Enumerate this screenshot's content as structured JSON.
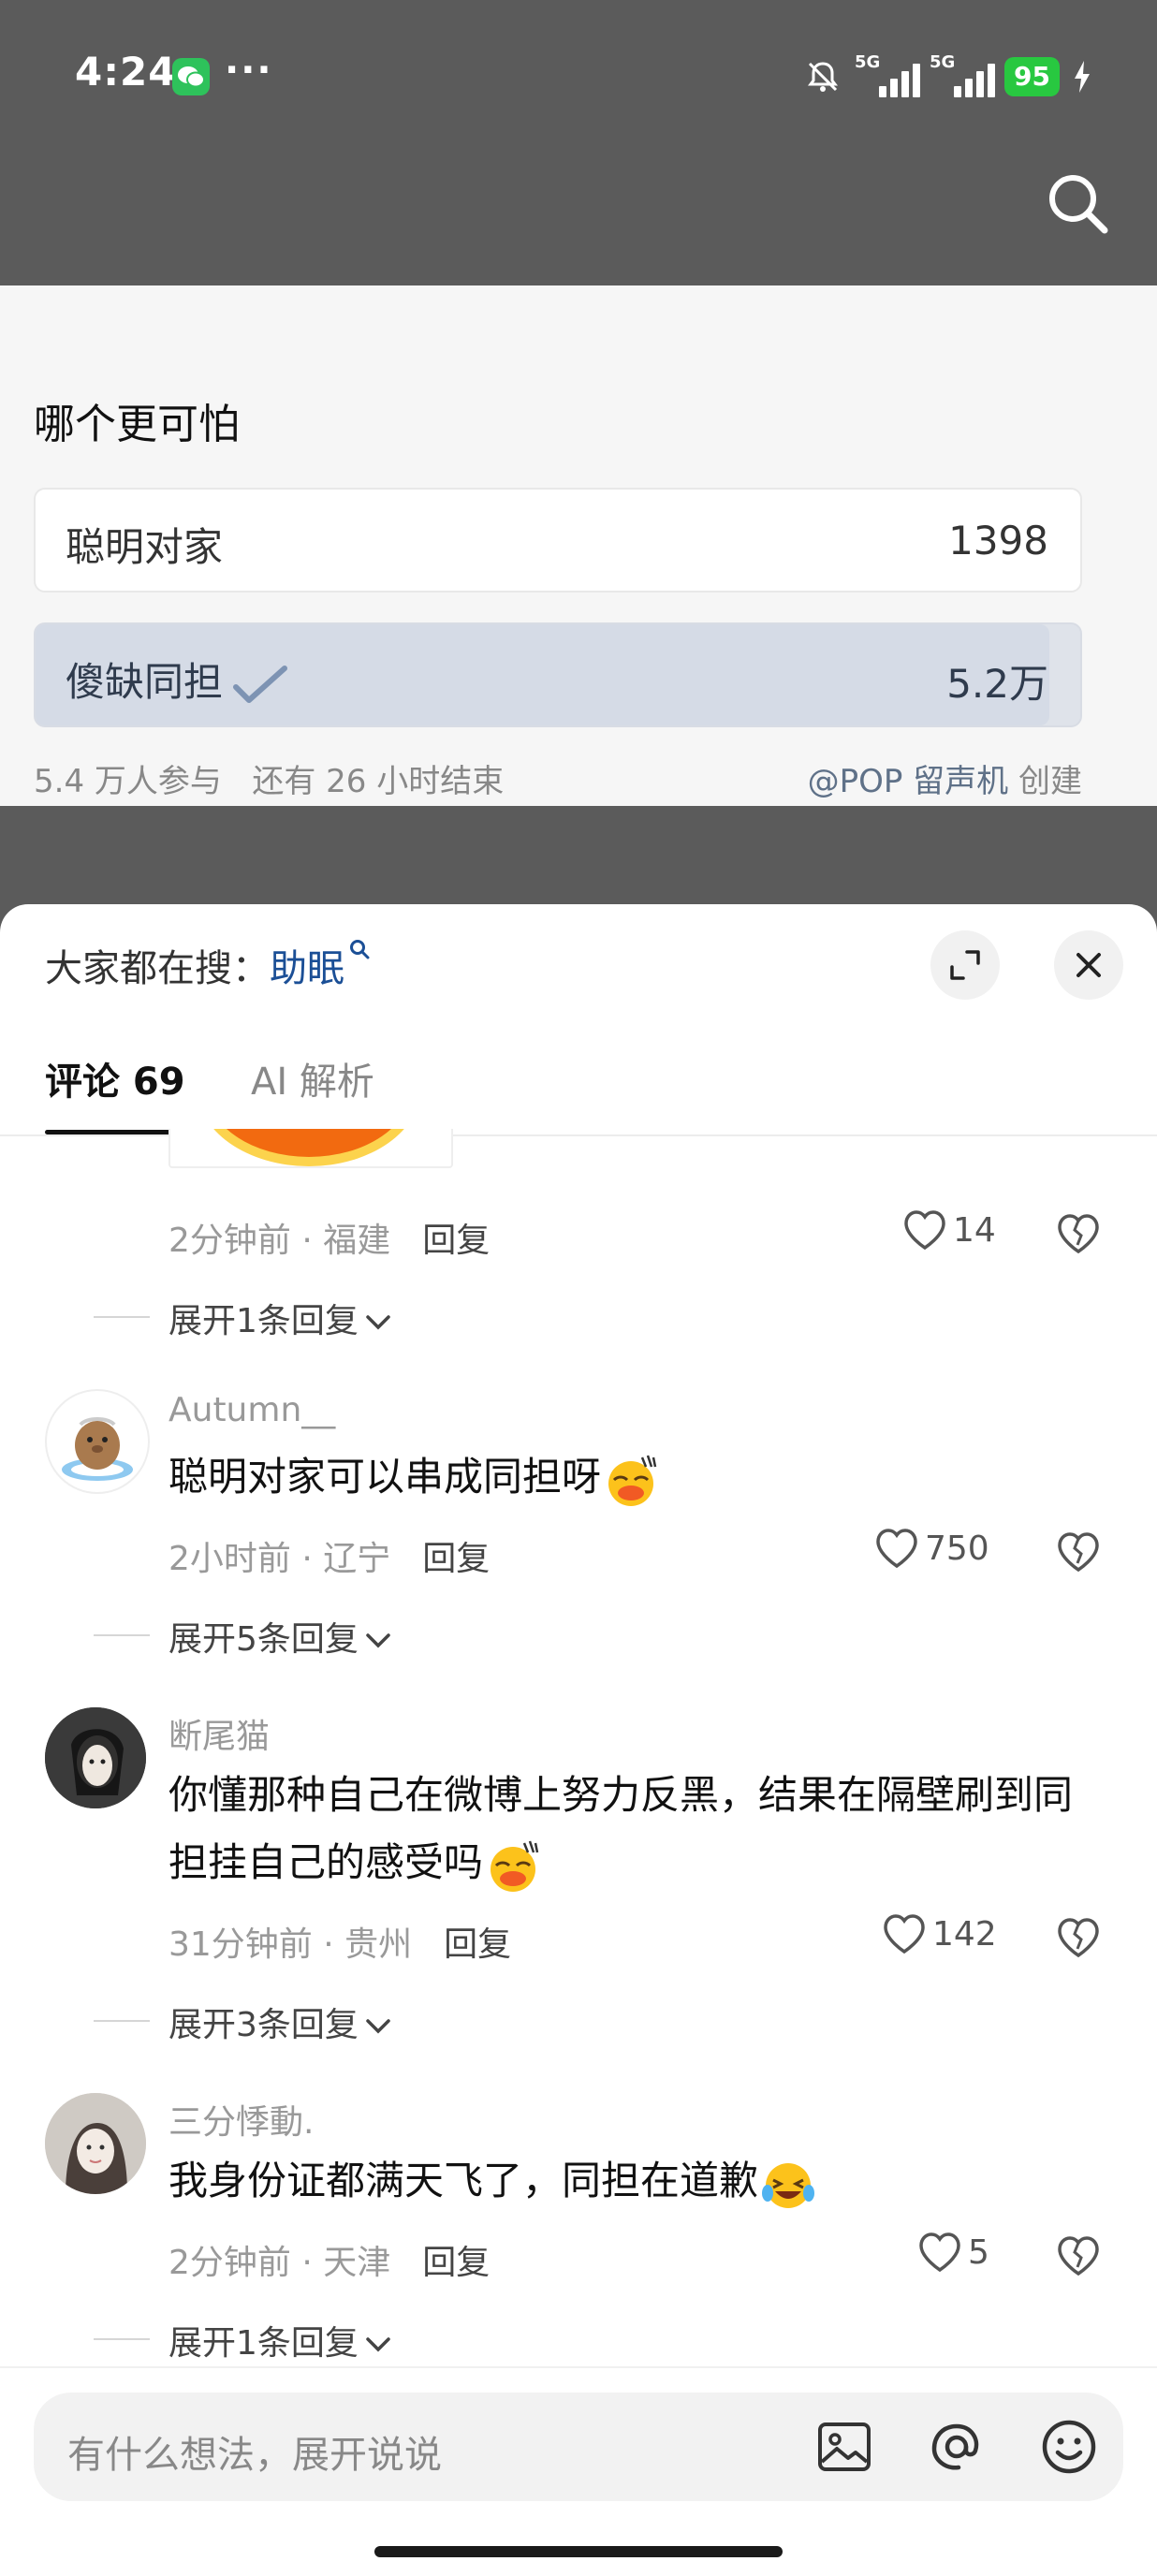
{
  "status_bar": {
    "time": "4:24",
    "dots": "···",
    "signal1": "5G",
    "signal2": "5G",
    "battery": "95"
  },
  "poll": {
    "question": "哪个更可怕",
    "options": [
      {
        "label": "聪明对家",
        "count": "1398",
        "selected": false
      },
      {
        "label": "傻缺同担",
        "count": "5.2万",
        "selected": true,
        "share": 0.97
      }
    ],
    "participants": "5.4 万人参与",
    "remaining": "还有 26 小时结束",
    "creator": "@POP 留声机",
    "creator_suffix": "创建"
  },
  "sheet": {
    "trending_prefix": "大家都在搜：",
    "trending_keyword": "助眠",
    "tabs": [
      {
        "label": "评论 69",
        "active": true
      },
      {
        "label": "AI 解析",
        "active": false
      }
    ]
  },
  "comments": [
    {
      "partial": true,
      "meta": "2分钟前 · 福建",
      "reply": "回复",
      "likes": "14",
      "expand": "展开1条回复"
    },
    {
      "name": "Autumn__",
      "text": "聪明对家可以串成同担呀",
      "meta": "2小时前 · 辽宁",
      "reply": "回复",
      "likes": "750",
      "expand": "展开5条回复"
    },
    {
      "name": "断尾猫",
      "text": "你懂那种自己在微博上努力反黑，结果在隔壁刷到同担挂自己的感受吗",
      "meta": "31分钟前 · 贵州",
      "reply": "回复",
      "likes": "142",
      "expand": "展开3条回复"
    },
    {
      "name": "三分悸動.",
      "text": "我身份证都满天飞了，同担在道歉",
      "meta": "2分钟前 · 天津",
      "reply": "回复",
      "likes": "5",
      "expand": "展开1条回复"
    }
  ],
  "input": {
    "placeholder": "有什么想法，展开说说"
  },
  "icons": [
    "wechat-icon",
    "mute-icon",
    "search-icon",
    "check-icon",
    "magnifier-icon",
    "expand-icon",
    "close-icon",
    "heart-icon",
    "broken-heart-icon",
    "chevron-down-icon",
    "image-icon",
    "at-icon",
    "emoji-icon"
  ],
  "colors": {
    "accent_blue": "#1b4f96",
    "battery_green": "#28c840"
  }
}
